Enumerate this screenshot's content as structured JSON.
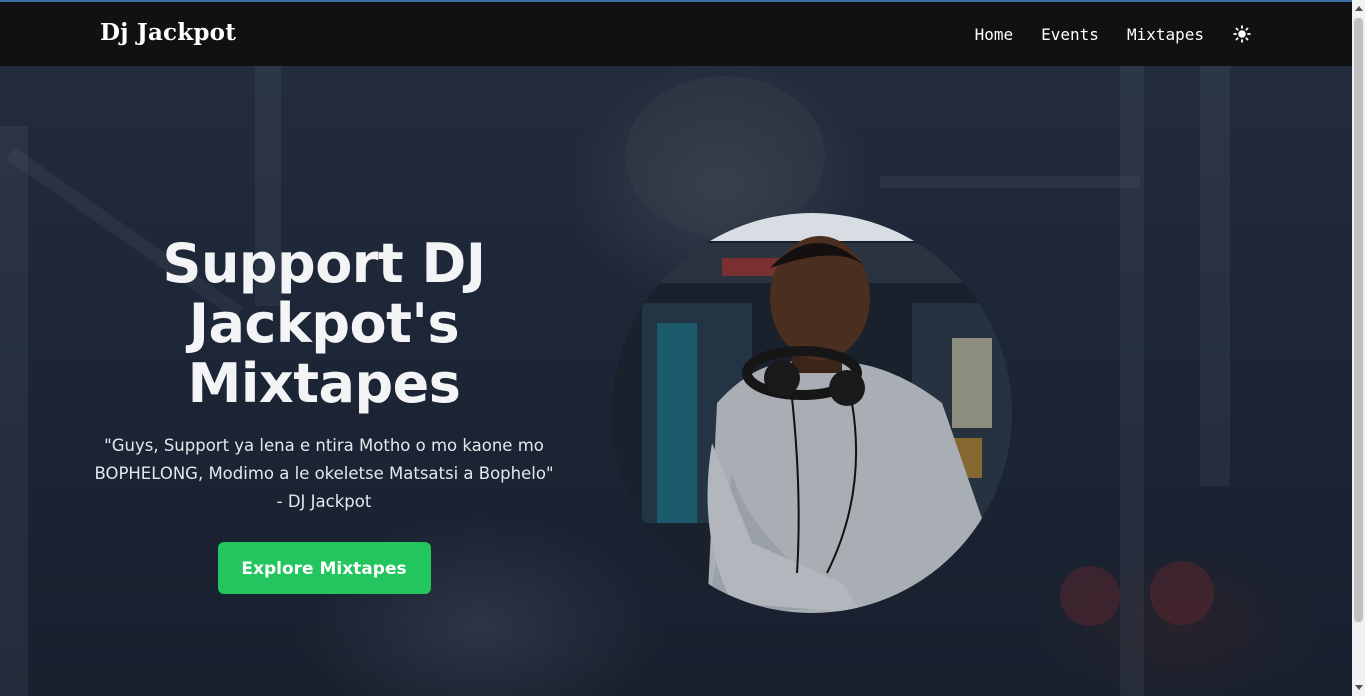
{
  "nav": {
    "brand": "Dj Jackpot",
    "links": [
      "Home",
      "Events",
      "Mixtapes"
    ],
    "theme_icon": "sun-icon"
  },
  "hero": {
    "title": "Support DJ Jackpot's Mixtapes",
    "quote_line1": "\"Guys, Support ya lena e ntira Motho o mo kaone mo",
    "quote_line2": "BOPHELONG, Modimo a le okeletse Matsatsi a Bophelo\"",
    "quote_author": "- DJ Jackpot",
    "cta_label": "Explore Mixtapes"
  },
  "colors": {
    "navbar_bg": "#111111",
    "accent_green": "#22c55e",
    "hero_bg": "#1c2535"
  }
}
